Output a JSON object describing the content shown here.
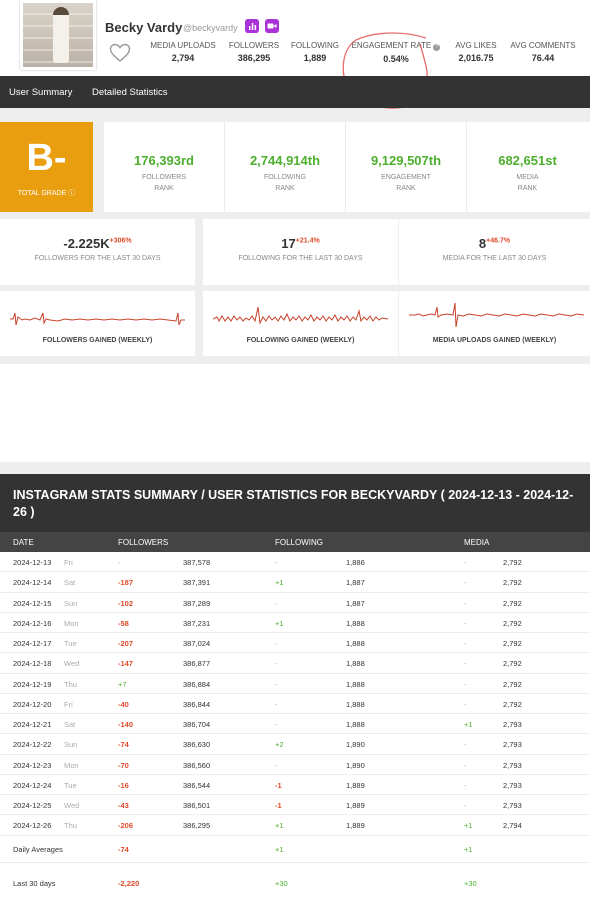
{
  "profile": {
    "name": "Becky Vardy",
    "handle": "@beckyvardy",
    "badge_chart_icon": "bar-chart-icon",
    "badge_video_icon": "video-icon"
  },
  "stats": [
    {
      "label": "MEDIA UPLOADS",
      "value": "2,794"
    },
    {
      "label": "FOLLOWERS",
      "value": "386,295"
    },
    {
      "label": "FOLLOWING",
      "value": "1,889"
    },
    {
      "label": "ENGAGEMENT RATE",
      "value": "0.54%"
    },
    {
      "label": "AVG LIKES",
      "value": "2,016.75"
    },
    {
      "label": "AVG COMMENTS",
      "value": "76.44"
    }
  ],
  "nav": {
    "tabs": [
      "User Summary",
      "Detailed Statistics"
    ]
  },
  "grade": {
    "letter": "B-",
    "label": "TOTAL GRADE"
  },
  "ranks": [
    {
      "value": "176,393rd",
      "label1": "FOLLOWERS",
      "label2": "RANK"
    },
    {
      "value": "2,744,914th",
      "label1": "FOLLOWING",
      "label2": "RANK"
    },
    {
      "value": "9,129,507th",
      "label1": "ENGAGEMENT",
      "label2": "RANK"
    },
    {
      "value": "682,651st",
      "label1": "MEDIA",
      "label2": "RANK"
    }
  ],
  "gains": [
    {
      "value": "-2.225K",
      "change": "+306%",
      "label": "FOLLOWERS FOR THE LAST 30 DAYS"
    },
    {
      "value": "17",
      "change": "+21.4%",
      "label": "FOLLOWING FOR THE LAST 30 DAYS"
    },
    {
      "value": "8",
      "change": "+46.7%",
      "label": "MEDIA FOR THE LAST 30 DAYS"
    }
  ],
  "sparks": [
    {
      "label": "FOLLOWERS GAINED (WEEKLY)"
    },
    {
      "label": "FOLLOWING GAINED (WEEKLY)"
    },
    {
      "label": "MEDIA UPLOADS GAINED (WEEKLY)"
    }
  ],
  "colors": {
    "accent_green": "#4caf2d",
    "accent_red": "#e04a2a",
    "grade_orange": "#e89e0f",
    "dark_bar": "#333333"
  },
  "table": {
    "title": "INSTAGRAM STATS SUMMARY / USER STATISTICS FOR BECKYVARDY ( 2024-12-13 - 2024-12-26 )",
    "headers": {
      "date": "DATE",
      "followers": "FOLLOWERS",
      "following": "FOLLOWING",
      "media": "MEDIA"
    },
    "rows": [
      {
        "date": "2024-12-13",
        "day": "Fri",
        "f_change": "-",
        "followers": "387,578",
        "fo_change": "-",
        "following": "1,886",
        "m_change": "-",
        "media": "2,792"
      },
      {
        "date": "2024-12-14",
        "day": "Sat",
        "f_change": "-187",
        "followers": "387,391",
        "fo_change": "+1",
        "following": "1,887",
        "m_change": "-",
        "media": "2,792"
      },
      {
        "date": "2024-12-15",
        "day": "Sun",
        "f_change": "-102",
        "followers": "387,289",
        "fo_change": "-",
        "following": "1,887",
        "m_change": "-",
        "media": "2,792"
      },
      {
        "date": "2024-12-16",
        "day": "Mon",
        "f_change": "-58",
        "followers": "387,231",
        "fo_change": "+1",
        "following": "1,888",
        "m_change": "-",
        "media": "2,792"
      },
      {
        "date": "2024-12-17",
        "day": "Tue",
        "f_change": "-207",
        "followers": "387,024",
        "fo_change": "-",
        "following": "1,888",
        "m_change": "-",
        "media": "2,792"
      },
      {
        "date": "2024-12-18",
        "day": "Wed",
        "f_change": "-147",
        "followers": "386,877",
        "fo_change": "-",
        "following": "1,888",
        "m_change": "-",
        "media": "2,792"
      },
      {
        "date": "2024-12-19",
        "day": "Thu",
        "f_change": "+7",
        "followers": "386,884",
        "fo_change": "-",
        "following": "1,888",
        "m_change": "-",
        "media": "2,792"
      },
      {
        "date": "2024-12-20",
        "day": "Fri",
        "f_change": "-40",
        "followers": "386,844",
        "fo_change": "-",
        "following": "1,888",
        "m_change": "-",
        "media": "2,792"
      },
      {
        "date": "2024-12-21",
        "day": "Sat",
        "f_change": "-140",
        "followers": "386,704",
        "fo_change": "-",
        "following": "1,888",
        "m_change": "+1",
        "media": "2,793"
      },
      {
        "date": "2024-12-22",
        "day": "Sun",
        "f_change": "-74",
        "followers": "386,630",
        "fo_change": "+2",
        "following": "1,890",
        "m_change": "-",
        "media": "2,793"
      },
      {
        "date": "2024-12-23",
        "day": "Mon",
        "f_change": "-70",
        "followers": "386,560",
        "fo_change": "-",
        "following": "1,890",
        "m_change": "-",
        "media": "2,793"
      },
      {
        "date": "2024-12-24",
        "day": "Tue",
        "f_change": "-16",
        "followers": "386,544",
        "fo_change": "-1",
        "following": "1,889",
        "m_change": "-",
        "media": "2,793"
      },
      {
        "date": "2024-12-25",
        "day": "Wed",
        "f_change": "-43",
        "followers": "386,501",
        "fo_change": "-1",
        "following": "1,889",
        "m_change": "-",
        "media": "2,793"
      },
      {
        "date": "2024-12-26",
        "day": "Thu",
        "f_change": "-206",
        "followers": "386,295",
        "fo_change": "+1",
        "following": "1,889",
        "m_change": "+1",
        "media": "2,794"
      }
    ],
    "daily_averages": {
      "label": "Daily Averages",
      "followers": "-74",
      "following": "+1",
      "media": "+1"
    },
    "last_30_days": {
      "label": "Last 30 days",
      "followers": "-2,220",
      "following": "+30",
      "media": "+30"
    }
  }
}
